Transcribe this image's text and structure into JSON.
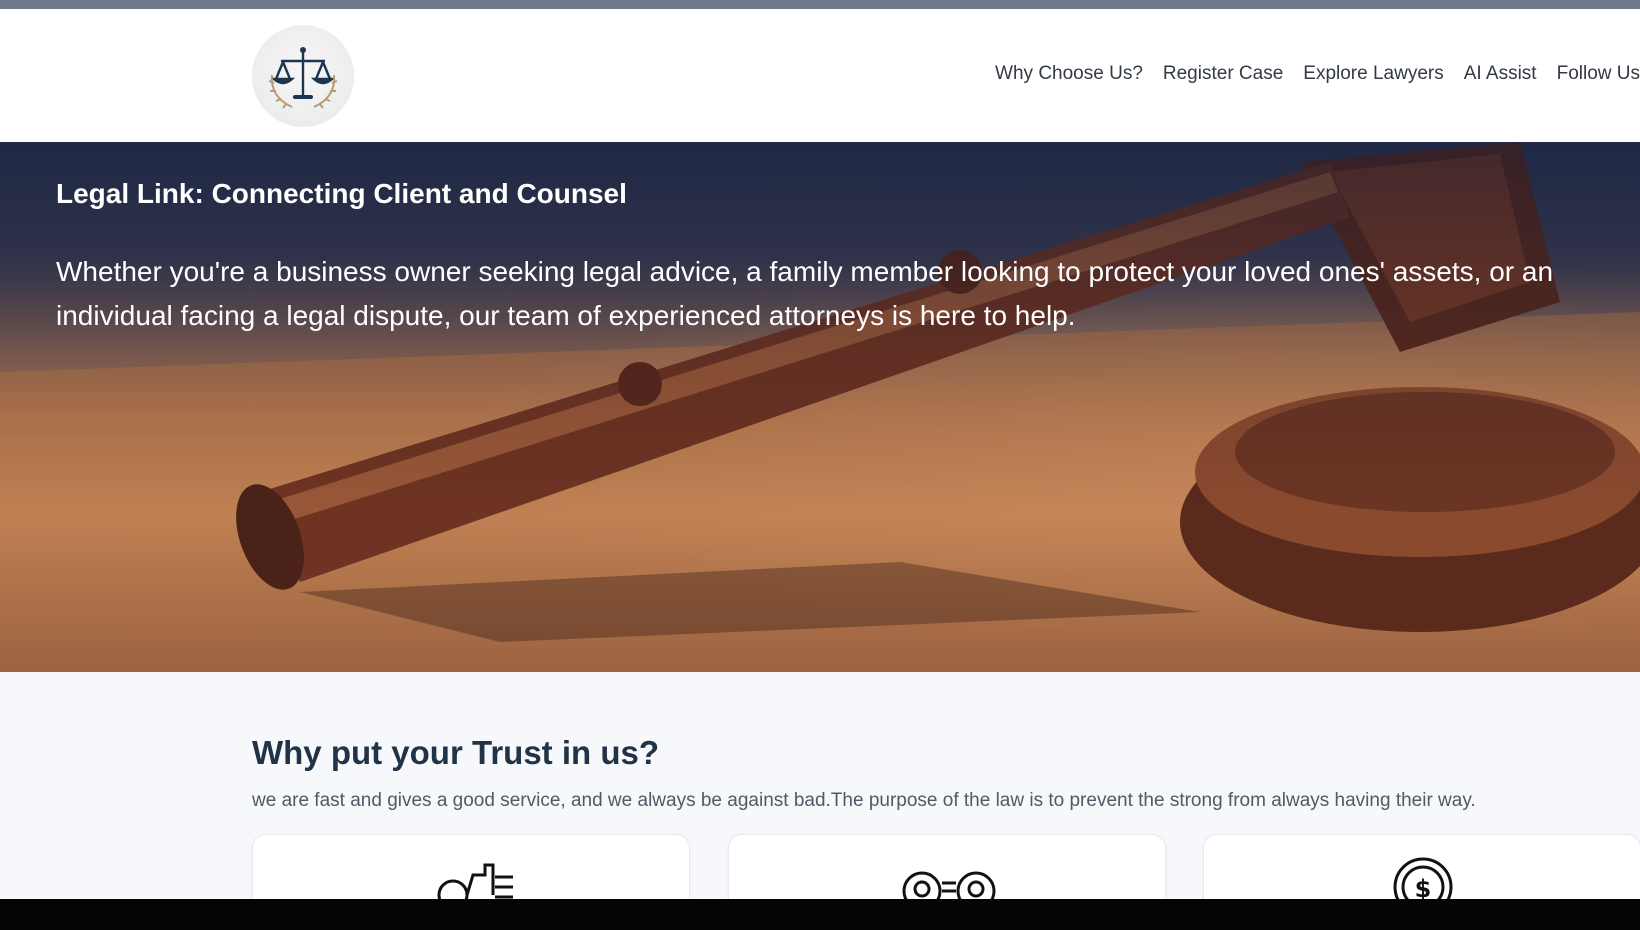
{
  "nav": {
    "logo_icon": "scales-of-justice-logo",
    "items": [
      {
        "label": "Why Choose Us?"
      },
      {
        "label": "Register Case"
      },
      {
        "label": "Explore Lawyers"
      },
      {
        "label": "AI Assist"
      },
      {
        "label": "Follow Us"
      }
    ]
  },
  "hero": {
    "title": "Legal Link: Connecting Client and Counsel",
    "text": "Whether you're a business owner seeking legal advice, a family member looking to protect your loved ones' assets, or an individual facing a legal dispute, our team of experienced attorneys is here to help.",
    "background": "gavel-image"
  },
  "trust": {
    "title": "Why put your Trust in us?",
    "description": "we are fast and gives a good service, and we always be against bad.The purpose of the law is to prevent the strong from always having their way.",
    "cards": [
      {
        "icon": "handshake-gear-icon"
      },
      {
        "icon": "people-exchange-icon"
      },
      {
        "icon": "dollar-coin-icon"
      }
    ]
  },
  "colors": {
    "nav_text": "#333a44",
    "section_title": "#213447",
    "hero_text": "#ffffff"
  }
}
